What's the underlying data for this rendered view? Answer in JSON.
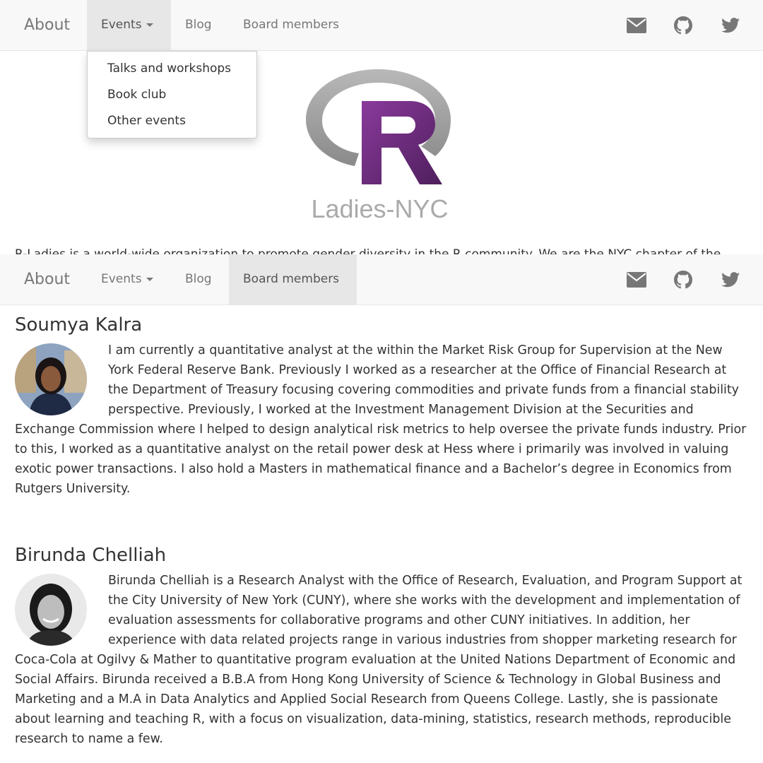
{
  "nav": {
    "brand": "About",
    "items": [
      {
        "label": "Events"
      },
      {
        "label": "Blog"
      },
      {
        "label": "Board members"
      }
    ],
    "icons": [
      "envelope-icon",
      "github-icon",
      "twitter-icon"
    ]
  },
  "events_menu": {
    "items": [
      {
        "label": "Talks and workshops"
      },
      {
        "label": "Book club"
      },
      {
        "label": "Other events"
      }
    ]
  },
  "logo": {
    "text": "Ladies-NYC",
    "letter": "R",
    "colors": {
      "ring": "#9e9e9e",
      "letter": "#6a2c7a"
    }
  },
  "intro_partial": "R-Ladies is a world-wide organization to promote gender diversity in the R community. We are the NYC chapter of the",
  "colors": {
    "navbar_bg": "#f8f8f8",
    "active_bg": "#e7e7e7",
    "text": "#333333",
    "muted": "#777777"
  },
  "board_members": [
    {
      "name": "Soumya Kalra",
      "bio": "I am currently a quantitative analyst at the within the Market Risk Group for Supervision at the New York Federal Reserve Bank. Previously I worked as a researcher at the Office of Financial Research at the Department of Treasury focusing covering commodities and private funds from a financial stability perspective. Previously, I worked at the Investment Management Division at the Securities and Exchange Commission where I helped to design analytical risk metrics to help oversee the private funds industry. Prior to this, I worked as a quantitative analyst on the retail power desk at Hess where i primarily was involved in valuing exotic power transactions. I also hold a Masters in mathematical finance and a Bachelor’s degree in Economics from Rutgers University."
    },
    {
      "name": "Birunda Chelliah",
      "bio": "Birunda Chelliah is a Research Analyst with the Office of Research, Evaluation, and Program Support at the City University of New York (CUNY), where she works with the development and implementation of evaluation assessments for collaborative programs and other CUNY initiatives. In addition, her experience with data related projects range in various industries from shopper marketing research for Coca-Cola at Ogilvy & Mather to quantitative program evaluation at the United Nations Department of Economic and Social Affairs. Birunda received a B.B.A from Hong Kong University of Science & Technology in Global Business and Marketing and a M.A in Data Analytics and Applied Social Research from Queens College. Lastly, she is passionate about learning and teaching R, with a focus on visualization, data-mining, statistics, research methods, reproducible research to name a few."
    }
  ]
}
